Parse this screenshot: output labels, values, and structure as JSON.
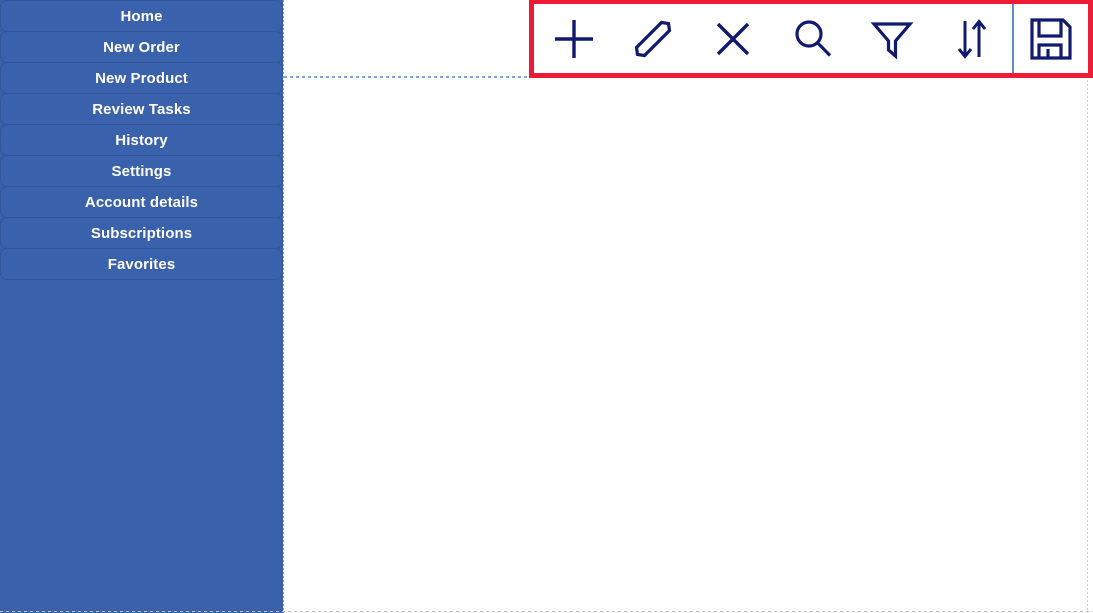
{
  "app": {
    "accent_blue": "#3a61ab",
    "icon_navy": "#101a6e",
    "highlight_red": "#ed1b36",
    "divider_blue": "#5b8fd4",
    "surface_white": "#ffffff"
  },
  "sidebar": {
    "name": "main-navigation",
    "items": [
      {
        "id": "home",
        "label": "Home"
      },
      {
        "id": "new-order",
        "label": "New Order"
      },
      {
        "id": "new-product",
        "label": "New Product"
      },
      {
        "id": "review-tasks",
        "label": "Review Tasks"
      },
      {
        "id": "history",
        "label": "History"
      },
      {
        "id": "settings",
        "label": "Settings"
      },
      {
        "id": "account-details",
        "label": "Account details"
      },
      {
        "id": "subscriptions",
        "label": "Subscriptions"
      },
      {
        "id": "favorites",
        "label": "Favorites"
      }
    ]
  },
  "toolbar": {
    "name": "record-actions-toolbar",
    "highlighted": true,
    "buttons": [
      {
        "id": "add",
        "icon": "plus-icon",
        "label": "Add"
      },
      {
        "id": "edit",
        "icon": "pencil-icon",
        "label": "Edit"
      },
      {
        "id": "delete",
        "icon": "close-icon",
        "label": "Delete"
      },
      {
        "id": "search",
        "icon": "search-icon",
        "label": "Search"
      },
      {
        "id": "filter",
        "icon": "filter-icon",
        "label": "Filter"
      },
      {
        "id": "sort",
        "icon": "sort-icon",
        "label": "Sort"
      }
    ],
    "trailing": [
      {
        "id": "save",
        "icon": "save-icon",
        "label": "Save"
      }
    ]
  },
  "content": {
    "name": "empty-content-area",
    "body_text": ""
  }
}
